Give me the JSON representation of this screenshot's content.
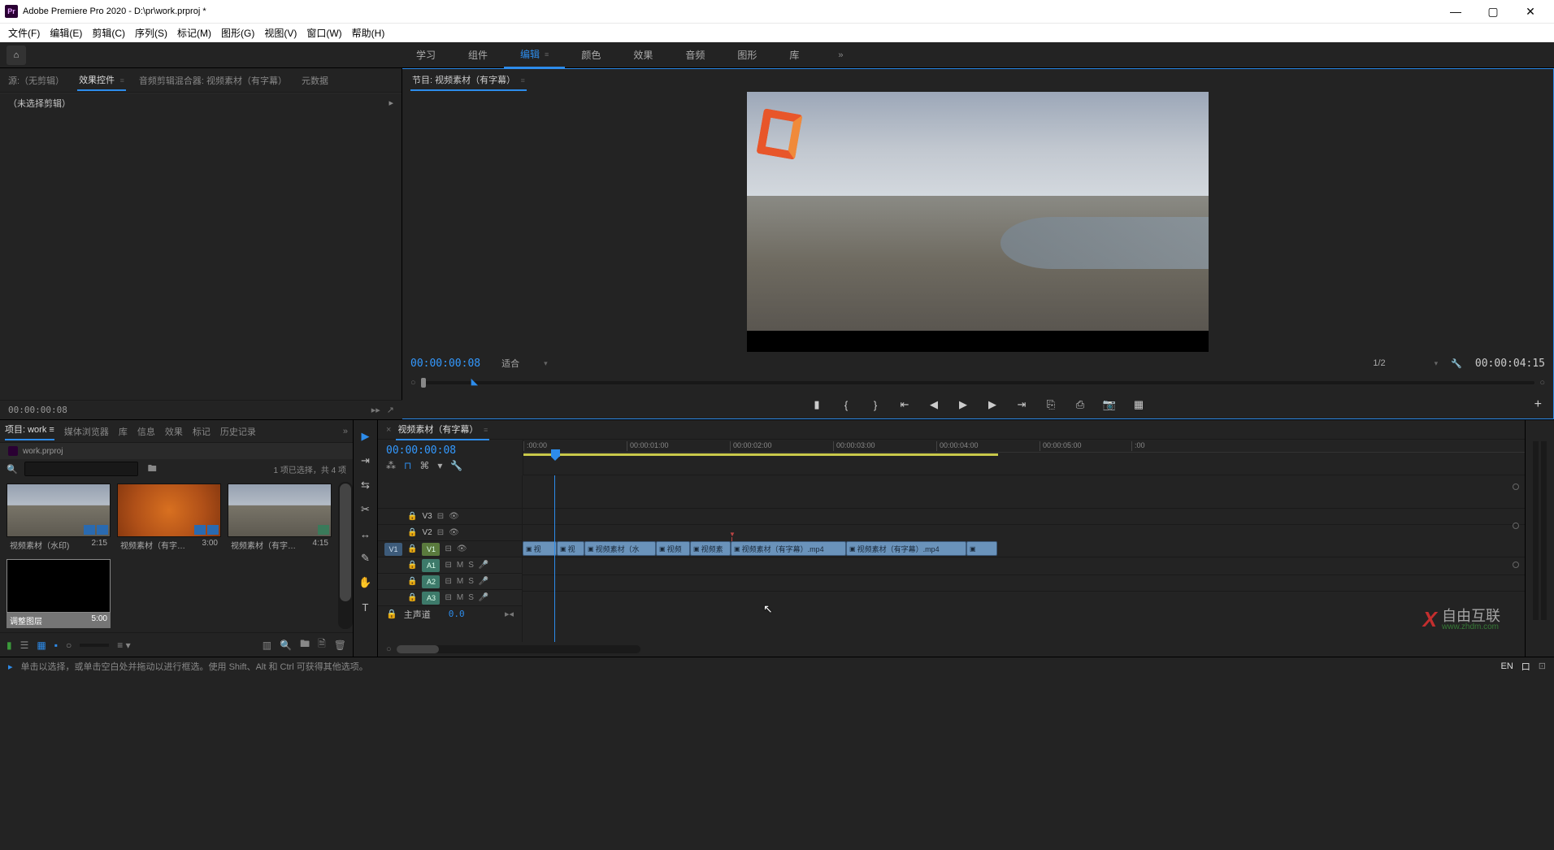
{
  "title_bar": {
    "app": "Adobe Premiere Pro 2020",
    "file": "D:\\pr\\work.prproj *"
  },
  "menu": {
    "file": "文件(F)",
    "edit": "编辑(E)",
    "clip": "剪辑(C)",
    "sequence": "序列(S)",
    "marker": "标记(M)",
    "graphic": "图形(G)",
    "view": "视图(V)",
    "window": "窗口(W)",
    "help": "帮助(H)"
  },
  "workspaces": {
    "learn": "学习",
    "assembly": "组件",
    "editing": "编辑",
    "color": "颜色",
    "effects": "效果",
    "audio": "音频",
    "graphics": "图形",
    "libraries": "库"
  },
  "source_tabs": {
    "source": "源:（无剪辑）",
    "effect_controls": "效果控件",
    "audio_mixer": "音频剪辑混合器: 视频素材（有字幕）",
    "metadata": "元数据"
  },
  "source_body": {
    "no_clip": "（未选择剪辑）"
  },
  "source_footer": {
    "tc": "00:00:00:08"
  },
  "program": {
    "label": "节目: 视频素材（有字幕）",
    "tc_left": "00:00:00:08",
    "fit": "适合",
    "zoom": "1/2",
    "tc_right": "00:00:04:15"
  },
  "project_tabs": {
    "project": "项目: work",
    "media_browser": "媒体浏览器",
    "libraries": "库",
    "info": "信息",
    "effects": "效果",
    "markers": "标记",
    "history": "历史记录"
  },
  "project": {
    "breadcrumb": "work.prproj",
    "selection": "1 项已选择，共 4 项"
  },
  "clips": [
    {
      "name": "视频素材（水印)",
      "dur": "2:15",
      "kind": "city"
    },
    {
      "name": "视频素材（有字…",
      "dur": "3:00",
      "kind": "leaves"
    },
    {
      "name": "视频素材（有字…",
      "dur": "4:15",
      "kind": "city"
    },
    {
      "name": "调整图层",
      "dur": "5:00",
      "kind": "black"
    }
  ],
  "timeline": {
    "tab": "视频素材（有字幕）",
    "tc": "00:00:00:08",
    "ruler": [
      ":00:00",
      "00:00:01:00",
      "00:00:02:00",
      "00:00:03:00",
      "00:00:04:00",
      "00:00:05:00",
      ":00"
    ],
    "tracks": {
      "v3": "V3",
      "v2": "V2",
      "v1": "V1",
      "a1": "A1",
      "a2": "A2",
      "a3": "A3",
      "main": "主声道",
      "main_val": "0.0",
      "m": "M",
      "s": "S",
      "src_v1": "V1"
    },
    "clipnames": [
      "视",
      "视",
      "视频素材（水",
      "视频",
      "视频素",
      "视频素材（有字幕）.mp4",
      "视频素材（有字幕）.mp4",
      ""
    ]
  },
  "status": {
    "hint": "单击以选择，或单击空白处并拖动以进行框选。使用 Shift、Alt 和 Ctrl 可获得其他选项。",
    "lang": "EN",
    "icon": "口"
  },
  "watermark": {
    "brand": "自由互联",
    "sub": "www.zhdm.com"
  }
}
